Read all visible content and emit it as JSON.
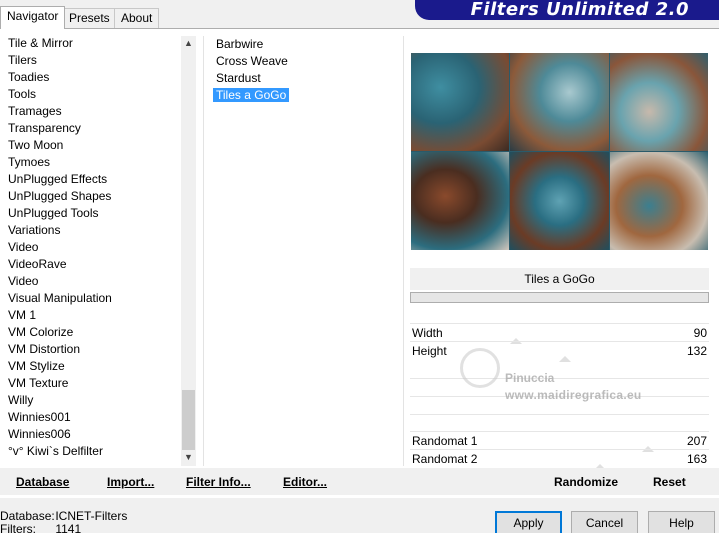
{
  "tabs": [
    {
      "label": "Navigator",
      "active": true
    },
    {
      "label": "Presets",
      "active": false
    },
    {
      "label": "About",
      "active": false
    }
  ],
  "banner": {
    "title": "Filters Unlimited 2.0",
    "color": "#1a1a8c"
  },
  "categories": [
    "Tile & Mirror",
    "Tilers",
    "Toadies",
    "Tools",
    "Tramages",
    "Transparency",
    "Two Moon",
    "Tymoes",
    "UnPlugged Effects",
    "UnPlugged Shapes",
    "UnPlugged Tools",
    "Variations",
    "Video",
    "VideoRave",
    "Video",
    "Visual Manipulation",
    "VM 1",
    "VM Colorize",
    "VM Distortion",
    "VM Stylize",
    "VM Texture",
    "Willy",
    "Winnies001",
    "Winnies006",
    "°v° Kiwi`s Delfilter"
  ],
  "filters": [
    {
      "label": "Barbwire",
      "selected": false
    },
    {
      "label": "Cross Weave",
      "selected": false
    },
    {
      "label": "Stardust",
      "selected": false
    },
    {
      "label": "Tiles a GoGo",
      "selected": true
    }
  ],
  "filter_panel": {
    "title": "Tiles a GoGo",
    "params": [
      {
        "label": "Width",
        "value": "90",
        "level": 0.35
      },
      {
        "label": "Height",
        "value": "132",
        "level": 0.52
      },
      {
        "label": "Randomat 1",
        "value": "207",
        "level": 0.81
      },
      {
        "label": "Randomat 2",
        "value": "163",
        "level": 0.64
      }
    ]
  },
  "watermark": {
    "name": "Pinuccia",
    "url": "www.maidiregrafica.eu"
  },
  "actions": {
    "database": "Database",
    "import": "Import...",
    "filter_info": "Filter Info...",
    "editor": "Editor...",
    "randomize": "Randomize",
    "reset": "Reset"
  },
  "status": {
    "database_label": "Database:",
    "database_value": "ICNET-Filters",
    "filters_label": "Filters:",
    "filters_value": "1141"
  },
  "buttons": {
    "apply": "Apply",
    "cancel": "Cancel",
    "help": "Help"
  },
  "colors": {
    "selection": "#3399ff",
    "default_button_border": "#0078d7"
  }
}
